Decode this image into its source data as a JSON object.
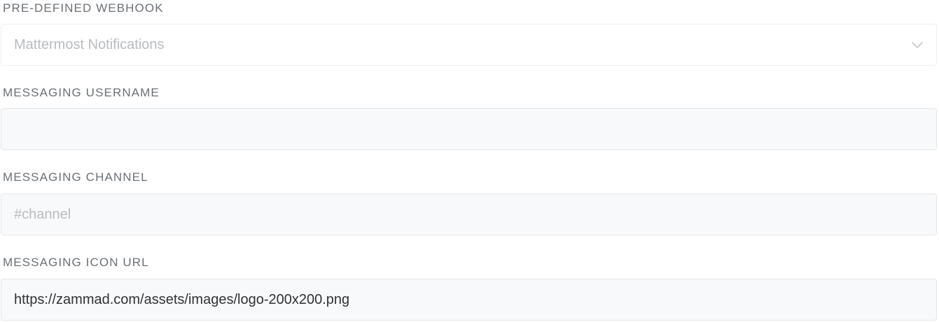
{
  "form": {
    "webhook": {
      "label": "PRE-DEFINED WEBHOOK",
      "selected": "Mattermost Notifications",
      "icon": "chevron-down-icon"
    },
    "username": {
      "label": "MESSAGING USERNAME",
      "value": "",
      "placeholder": ""
    },
    "channel": {
      "label": "MESSAGING CHANNEL",
      "value": "",
      "placeholder": "#channel"
    },
    "icon_url": {
      "label": "MESSAGING ICON URL",
      "value": "https://zammad.com/assets/images/logo-200x200.png"
    }
  }
}
